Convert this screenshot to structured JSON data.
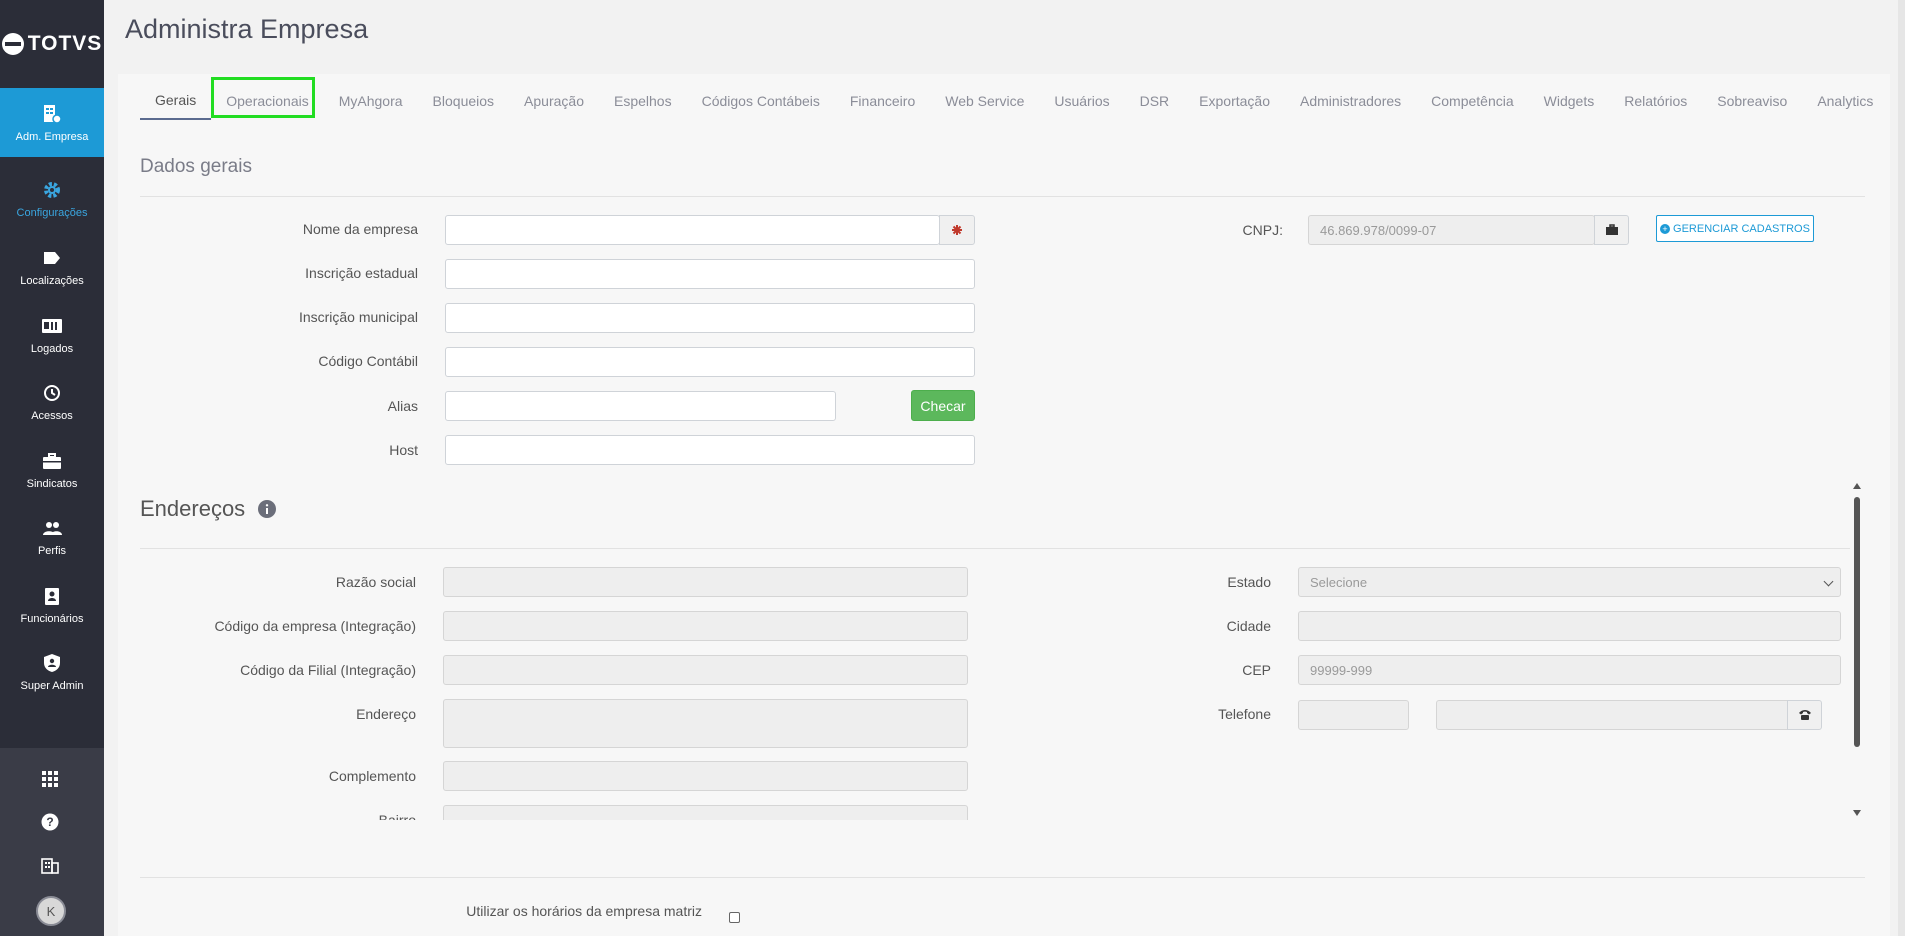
{
  "sidebar": {
    "brand": "TOTVS",
    "items": [
      {
        "label": "Adm. Empresa",
        "icon": "building-gear-icon"
      },
      {
        "label": "Configurações",
        "icon": "gear-icon"
      },
      {
        "label": "Localizações",
        "icon": "tag-icon"
      },
      {
        "label": "Logados",
        "icon": "id-card-icon"
      },
      {
        "label": "Acessos",
        "icon": "history-icon"
      },
      {
        "label": "Sindicatos",
        "icon": "briefcase-icon"
      },
      {
        "label": "Perfis",
        "icon": "users-icon"
      },
      {
        "label": "Funcionários",
        "icon": "badge-icon"
      },
      {
        "label": "Super Admin",
        "icon": "shield-icon"
      }
    ],
    "avatar_initial": "K"
  },
  "page": {
    "title": "Administra Empresa"
  },
  "tabs": [
    "Gerais",
    "Operacionais",
    "MyAhgora",
    "Bloqueios",
    "Apuração",
    "Espelhos",
    "Códigos Contábeis",
    "Financeiro",
    "Web Service",
    "Usuários",
    "DSR",
    "Exportação",
    "Administradores",
    "Competência",
    "Widgets",
    "Relatórios",
    "Sobreaviso",
    "Analytics"
  ],
  "dados_gerais": {
    "title": "Dados gerais",
    "nome_empresa": "Nome da empresa",
    "inscricao_estadual": "Inscrição estadual",
    "inscricao_municipal": "Inscrição municipal",
    "codigo_contabil": "Código Contábil",
    "alias": "Alias",
    "host": "Host",
    "checar": "Checar",
    "cnpj_label": "CNPJ:",
    "cnpj_value": "46.869.978/0099-07",
    "gerenciar": "GERENCIAR CADASTROS"
  },
  "enderecos": {
    "title": "Endereços",
    "razao_social": "Razão social",
    "codigo_empresa": "Código da empresa (Integração)",
    "codigo_filial": "Código da Filial (Integração)",
    "endereco": "Endereço",
    "complemento": "Complemento",
    "bairro": "Bairro",
    "estado": "Estado",
    "estado_placeholder": "Selecione",
    "cidade": "Cidade",
    "cep": "CEP",
    "cep_placeholder": "99999-999",
    "telefone": "Telefone"
  },
  "footer": {
    "matriz_label": "Utilizar os horários da empresa matriz"
  },
  "colors": {
    "sidebar": "#2b2d38",
    "active": "#1d9ad6",
    "green": "#5cb85c"
  }
}
